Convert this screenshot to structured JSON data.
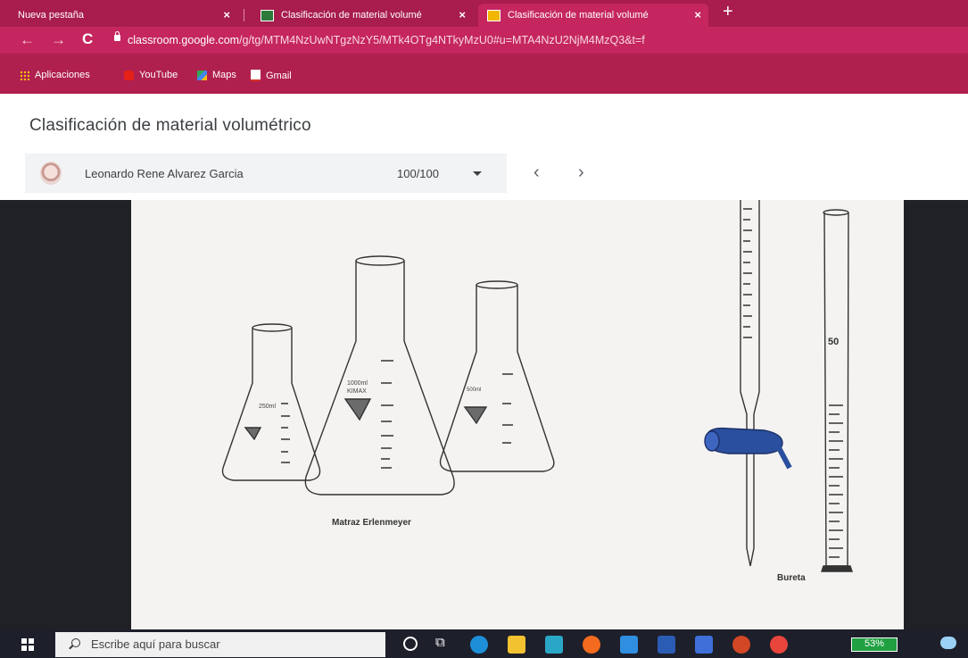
{
  "browser": {
    "tabs": [
      {
        "title": "Nueva pestaña"
      },
      {
        "title": "Clasificación de material volumé"
      },
      {
        "title": "Clasificación de material volumé"
      }
    ],
    "url_host": "classroom.google.com",
    "url_path": "/g/tg/MTM4NzUwNTgzNzY5/MTk4OTg4NTkyMzU0#u=MTA4NzU2NjM4MzQ3&t=f",
    "bookmarks": [
      "Aplicaciones",
      "YouTube",
      "Maps",
      "Gmail"
    ]
  },
  "page": {
    "title": "Clasificación de material volumétrico",
    "student_name": "Leonardo Rene Alvarez Garcia",
    "grade": "100/100"
  },
  "drawing": {
    "flask_caption": "Matraz Erlenmeyer",
    "buret_caption": "Bureta",
    "flask_small_volume": "250ml",
    "flask_large_volume": "1000ml",
    "flask_medium_volume": "500ml",
    "brand": "KIMAX",
    "cylinder_mark": "50"
  },
  "taskbar": {
    "search_placeholder": "Escribe aquí para buscar",
    "battery": "53%"
  },
  "colors": {
    "tab_bar": "#a81c4e",
    "address_bar": "#c5265f",
    "stopcock": "#2a4f9e"
  }
}
